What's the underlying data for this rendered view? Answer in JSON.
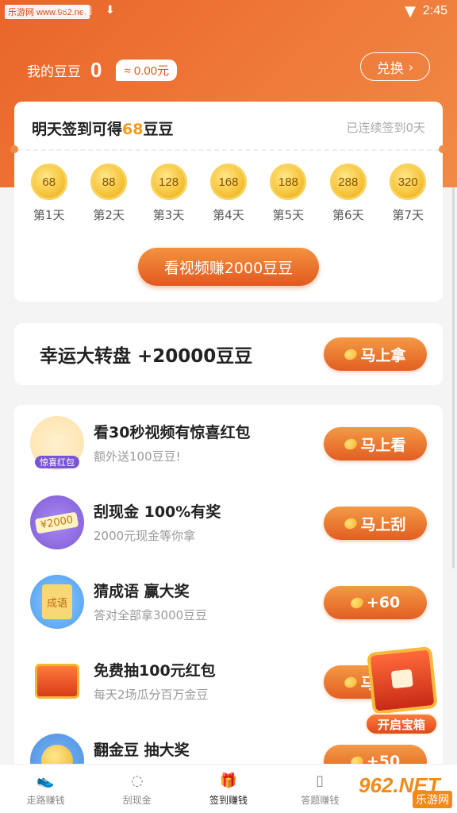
{
  "status_bar": {
    "badge": "乐游网 www.962.net",
    "icons": "✉ ▣ ⬇",
    "time": "2:45"
  },
  "header": {
    "bean_label": "我的豆豆",
    "bean_count": "0",
    "cash": "≈ 0.00元",
    "exchange_label": "兑换"
  },
  "signin": {
    "title_prefix": "明天签到可得",
    "title_amount": "68",
    "title_suffix": "豆豆",
    "streak": "已连续签到0天",
    "days": [
      {
        "value": "68",
        "label": "第1天"
      },
      {
        "value": "88",
        "label": "第2天"
      },
      {
        "value": "128",
        "label": "第3天"
      },
      {
        "value": "168",
        "label": "第4天"
      },
      {
        "value": "188",
        "label": "第5天"
      },
      {
        "value": "288",
        "label": "第6天"
      },
      {
        "value": "320",
        "label": "第7天"
      }
    ],
    "video_button": "看视频赚2000豆豆"
  },
  "wheel": {
    "title": "幸运大转盘 +20000豆豆",
    "button": "马上拿"
  },
  "tasks": [
    {
      "title": "看30秒视频有惊喜红包",
      "subtitle": "额外送100豆豆!",
      "button": "马上看",
      "icon_tag": "惊喜红包",
      "icon": "red-packet-icon"
    },
    {
      "title": "刮现金 100%有奖",
      "subtitle": "2000元现金等你拿",
      "button": "马上刮",
      "icon_tag": "¥2000",
      "icon": "scratch-card-icon"
    },
    {
      "title": "猜成语 赢大奖",
      "subtitle": "答对全部拿3000豆豆",
      "button": "+60",
      "icon_tag": "成语",
      "icon": "idiom-book-icon"
    },
    {
      "title": "免费抽100元红包",
      "subtitle": "每天2场瓜分百万金豆",
      "button": "马上抽",
      "icon": "treasure-chest-icon"
    },
    {
      "title": "翻金豆 抽大奖",
      "subtitle": "",
      "button": "+50",
      "icon": "gold-coin-icon"
    }
  ],
  "floating": {
    "label": "开启宝箱"
  },
  "nav": [
    {
      "label": "走路赚钱",
      "icon": "shoe-icon",
      "glyph": "👟",
      "active": false
    },
    {
      "label": "刮现金",
      "icon": "bean-icon",
      "glyph": "◌",
      "active": false
    },
    {
      "label": "签到赚钱",
      "icon": "gift-icon",
      "glyph": "🎁",
      "active": true
    },
    {
      "label": "答题赚钱",
      "icon": "book-icon",
      "glyph": "▯",
      "active": false
    },
    {
      "label": "",
      "icon": "user-icon",
      "glyph": "",
      "active": false
    }
  ],
  "watermark": {
    "brand": "962.NET",
    "site": "乐游网"
  },
  "colors": {
    "brand_orange": "#e9652a",
    "button_orange": "#e25e22",
    "highlight": "#f29a1a"
  }
}
